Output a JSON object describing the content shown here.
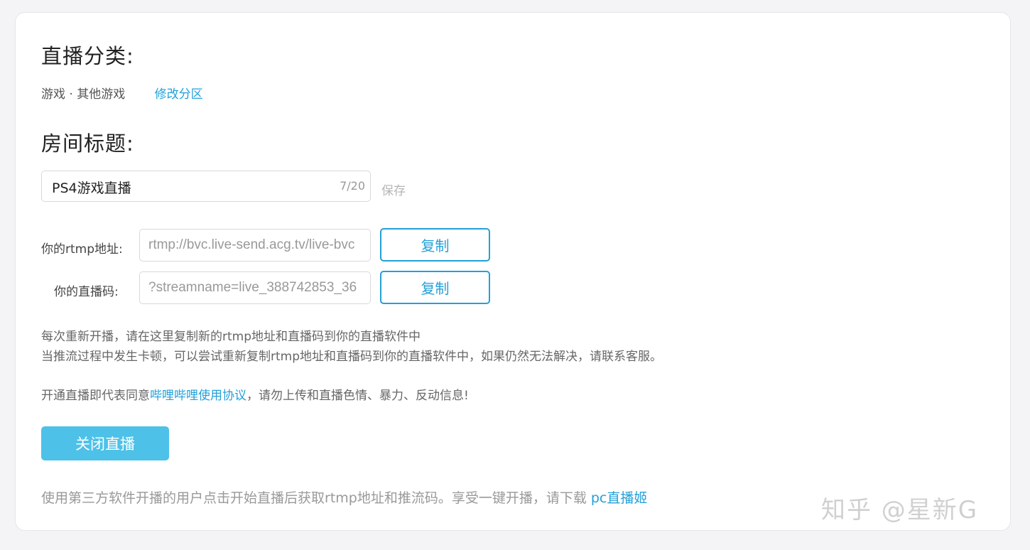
{
  "category": {
    "title": "直播分类:",
    "value": "游戏 · 其他游戏",
    "change_link": "修改分区"
  },
  "room": {
    "title": "房间标题:",
    "input_value": "PS4游戏直播",
    "counter": "7/20",
    "save_label": "保存"
  },
  "stream": {
    "rtmp_label": "你的rtmp地址:",
    "rtmp_value": "rtmp://bvc.live-send.acg.tv/live-bvc",
    "code_label": "你的直播码:",
    "code_value": "?streamname=live_388742853_36",
    "copy_label": "复制"
  },
  "info": {
    "line1": "每次重新开播，请在这里复制新的rtmp地址和直播码到你的直播软件中",
    "line2": "当推流过程中发生卡顿，可以尝试重新复制rtmp地址和直播码到你的直播软件中，如果仍然无法解决，请联系客服。",
    "agreement_prefix": "开通直播即代表同意",
    "agreement_link": "哔哩哔哩使用协议",
    "agreement_suffix": "，请勿上传和直播色情、暴力、反动信息!"
  },
  "actions": {
    "close_label": "关闭直播"
  },
  "footer": {
    "note": "使用第三方软件开播的用户点击开始直播后获取rtmp地址和推流码。享受一键开播，请下载 ",
    "pc_link": "pc直播姬"
  },
  "watermark": "知乎 @星新G",
  "colors": {
    "accent": "#23a0d8",
    "primary_button": "#4dc1e8"
  }
}
